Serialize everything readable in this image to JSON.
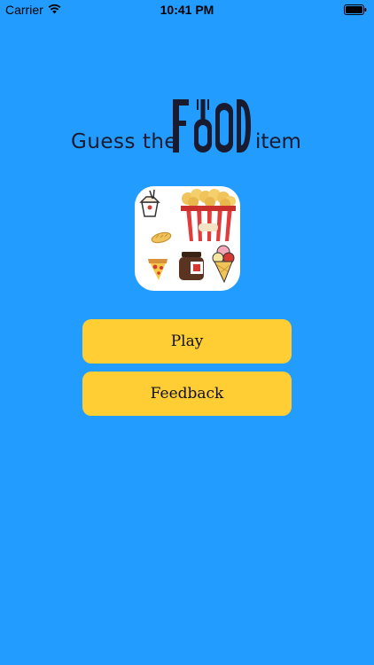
{
  "status_bar": {
    "carrier": "Carrier",
    "time": "10:41 PM",
    "wifi_icon": "wifi-icon",
    "battery_icon": "battery-icon"
  },
  "title": {
    "prefix": "Guess the",
    "highlight": "FOOD",
    "suffix": "item"
  },
  "app_icon": {
    "items": [
      "takeout-box-icon",
      "popcorn-bucket-icon",
      "bread-icon",
      "pizza-slice-icon",
      "jar-icon",
      "ice-cream-cone-icon"
    ]
  },
  "buttons": {
    "play": "Play",
    "feedback": "Feedback"
  },
  "colors": {
    "background": "#229cff",
    "button": "#fece34",
    "title_text": "#1a1a2e"
  }
}
